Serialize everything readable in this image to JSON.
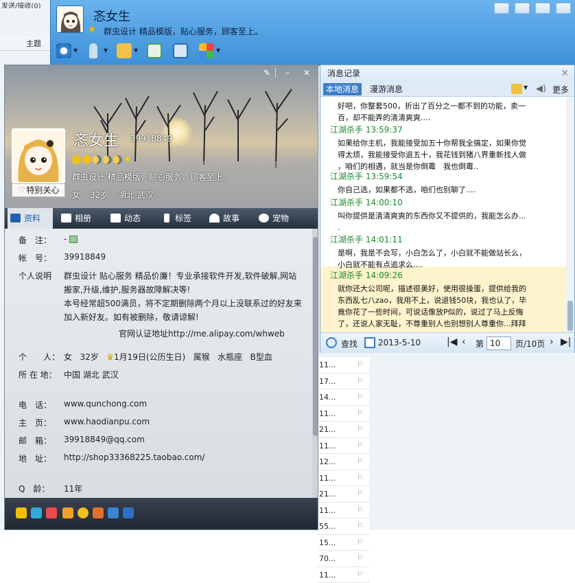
{
  "background_window": {
    "title": "发送/接收(0)",
    "column_header": "主题",
    "list_items": [
      "11...",
      "17...",
      "14...",
      "11...",
      "21...",
      "11...",
      "12...",
      "11...",
      "21...",
      "11...",
      "55...",
      "15...",
      "70...",
      "11..."
    ]
  },
  "chat": {
    "name": "忞女生",
    "signature": "群虫设计 精品模版，贴心服务，顾客至上。",
    "controls": [
      "▭",
      "▫",
      "–",
      "✕"
    ]
  },
  "profile": {
    "name": "忞女生",
    "qq": "39918849",
    "signature": "群虫设计 精品模版，贴心服务，顾客至上。",
    "gender": "女",
    "age": "32岁",
    "location": "湖北 武汉",
    "special_care": "特别关心",
    "tabs": [
      "资料",
      "相册",
      "动态",
      "标签",
      "故事",
      "宠物"
    ],
    "fields": {
      "remark_label": "备　注：",
      "remark_value": "-",
      "account_label": "帐　号：",
      "account_value": "39918849",
      "desc_label": "个人说明",
      "desc_line1": "群虫设计 贴心服务 精品价廉！专业承接软件开发,软件破解,网站",
      "desc_line2": "搬家,升级,维护,服务器故障解决等!",
      "desc_line3": "本号经常超500满员，将不定期删除两个月以上没联系过的好友来",
      "desc_line4": "加入新好友。如有被删除，敬请谅解!",
      "desc_line5": "官网认证地址http://me.alipay.com/whweb",
      "personal_label": "个　　人：",
      "personal_gender": "女",
      "personal_age": "32岁",
      "personal_birthday": "1月19日(公历生日)",
      "personal_zodiac": "属猴",
      "personal_star": "水瓶座",
      "personal_blood": "B型血",
      "location_label": "所 在 地：",
      "location_value": "中国 湖北 武汉",
      "phone_label": "电　话：",
      "phone_value": "www.qunchong.com",
      "homepage_label": "主　页：",
      "homepage_value": "www.haodianpu.com",
      "email_label": "邮　箱：",
      "email_value": "39918849@qq.com",
      "address_label": "地　址：",
      "address_value": "http://shop33368225.taobao.com/",
      "qage_label": "Q　龄：",
      "qage_value": "11年"
    }
  },
  "messages": {
    "title": "消息记录",
    "tab_local": "本地消息",
    "tab_roam": "漫游消息",
    "more": "更多",
    "items": [
      {
        "text": "好吧，你整套500，折出了百分之一都不到的功能，卖一\n百，却不能弄的清清爽爽...."
      },
      {
        "head": "江湖杀手 13:59:37",
        "text": "如果给你主机，我能接受加五十你帮我全搞定，如果你觉\n得太烦，我能接受你退五十，我花钱到猪八界重新找人做\n，咱们的相遇，就当是你倒霉　我也倒霉.."
      },
      {
        "head": "江湖杀手 13:59:54",
        "text": "你自己选，如果都不选，咱们也别聊了...."
      },
      {
        "head": "江湖杀手 14:00:10",
        "text": "叫你提供是清清爽爽的东西你又不提供的，我能怎么办...\n."
      },
      {
        "head": "江湖杀手 14:01:11",
        "text": "是啊，我是不会写，小白怎么了，小白就不能做站长么，\n小白就不能有点追求么...."
      },
      {
        "head": "江湖杀手 14:09:26",
        "text": "就你还大公司呢，描述很美好，使用很操蛋，提供给我的\n东西乱七八zao，我用不上，说退钱50块，我也认了，毕\n竟你花了一些时间，可说话像放P似的，说过了马上反悔\n了，还说人家无耻，不尊重别人也别想别人尊重你...拜拜\n..."
      }
    ],
    "find": "查找",
    "date": "2013-5-10",
    "page_prefix": "第",
    "page_value": "10",
    "page_suffix": "页/10页"
  }
}
